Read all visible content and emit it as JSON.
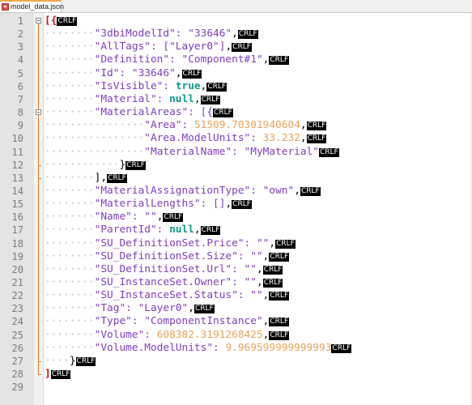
{
  "tab": {
    "label": "model_data.json"
  },
  "crlf_label": "CRLF",
  "lines": [
    {
      "n": "1",
      "segs": [
        {
          "t": "br",
          "v": "[{"
        }
      ]
    },
    {
      "n": "2",
      "segs": [
        {
          "t": "ws",
          "v": "········"
        },
        {
          "t": "str",
          "v": "\"3dbiModelId\": \"33646\""
        },
        {
          "t": "punc",
          "v": ","
        }
      ]
    },
    {
      "n": "3",
      "segs": [
        {
          "t": "ws",
          "v": "········"
        },
        {
          "t": "str",
          "v": "\"AllTags\": [\"Layer0\"]"
        },
        {
          "t": "punc",
          "v": ","
        }
      ]
    },
    {
      "n": "4",
      "segs": [
        {
          "t": "ws",
          "v": "········"
        },
        {
          "t": "str",
          "v": "\"Definition\": \"Component#1\""
        },
        {
          "t": "punc",
          "v": ","
        }
      ]
    },
    {
      "n": "5",
      "segs": [
        {
          "t": "ws",
          "v": "········"
        },
        {
          "t": "str",
          "v": "\"Id\": \"33646\""
        },
        {
          "t": "punc",
          "v": ","
        }
      ]
    },
    {
      "n": "6",
      "segs": [
        {
          "t": "ws",
          "v": "········"
        },
        {
          "t": "str",
          "v": "\"IsVisible\": "
        },
        {
          "t": "kw",
          "v": "true"
        },
        {
          "t": "punc",
          "v": ","
        }
      ]
    },
    {
      "n": "7",
      "segs": [
        {
          "t": "ws",
          "v": "········"
        },
        {
          "t": "str",
          "v": "\"Material\": "
        },
        {
          "t": "kw",
          "v": "null"
        },
        {
          "t": "punc",
          "v": ","
        }
      ]
    },
    {
      "n": "8",
      "segs": [
        {
          "t": "ws",
          "v": "········"
        },
        {
          "t": "str",
          "v": "\"MaterialAreas\": [{"
        }
      ]
    },
    {
      "n": "9",
      "segs": [
        {
          "t": "ws",
          "v": "················"
        },
        {
          "t": "str",
          "v": "\"Area\": "
        },
        {
          "t": "num",
          "v": "51509.70301940604"
        },
        {
          "t": "punc",
          "v": ","
        }
      ]
    },
    {
      "n": "10",
      "segs": [
        {
          "t": "ws",
          "v": "················"
        },
        {
          "t": "str",
          "v": "\"Area.ModelUnits\": "
        },
        {
          "t": "num",
          "v": "33.232"
        },
        {
          "t": "punc",
          "v": ","
        }
      ]
    },
    {
      "n": "11",
      "segs": [
        {
          "t": "ws",
          "v": "················"
        },
        {
          "t": "str",
          "v": "\"MaterialName\": \"MyMaterial\""
        }
      ]
    },
    {
      "n": "12",
      "segs": [
        {
          "t": "ws",
          "v": "············"
        },
        {
          "t": "punc",
          "v": "}"
        }
      ]
    },
    {
      "n": "13",
      "segs": [
        {
          "t": "ws",
          "v": "········"
        },
        {
          "t": "punc",
          "v": "],"
        }
      ]
    },
    {
      "n": "14",
      "segs": [
        {
          "t": "ws",
          "v": "········"
        },
        {
          "t": "str",
          "v": "\"MaterialAssignationType\": \"own\""
        },
        {
          "t": "punc",
          "v": ","
        }
      ]
    },
    {
      "n": "15",
      "segs": [
        {
          "t": "ws",
          "v": "········"
        },
        {
          "t": "str",
          "v": "\"MaterialLengths\": []"
        },
        {
          "t": "punc",
          "v": ","
        }
      ]
    },
    {
      "n": "16",
      "segs": [
        {
          "t": "ws",
          "v": "········"
        },
        {
          "t": "str",
          "v": "\"Name\": \"\""
        },
        {
          "t": "punc",
          "v": ","
        }
      ]
    },
    {
      "n": "17",
      "segs": [
        {
          "t": "ws",
          "v": "········"
        },
        {
          "t": "str",
          "v": "\"ParentId\": "
        },
        {
          "t": "kw",
          "v": "null"
        },
        {
          "t": "punc",
          "v": ","
        }
      ]
    },
    {
      "n": "18",
      "segs": [
        {
          "t": "ws",
          "v": "········"
        },
        {
          "t": "str",
          "v": "\"SU_DefinitionSet.Price\": \"\""
        },
        {
          "t": "punc",
          "v": ","
        }
      ]
    },
    {
      "n": "19",
      "segs": [
        {
          "t": "ws",
          "v": "········"
        },
        {
          "t": "str",
          "v": "\"SU_DefinitionSet.Size\": \"\""
        },
        {
          "t": "punc",
          "v": ","
        }
      ]
    },
    {
      "n": "20",
      "segs": [
        {
          "t": "ws",
          "v": "········"
        },
        {
          "t": "str",
          "v": "\"SU_DefinitionSet.Url\": \"\""
        },
        {
          "t": "punc",
          "v": ","
        }
      ]
    },
    {
      "n": "21",
      "segs": [
        {
          "t": "ws",
          "v": "········"
        },
        {
          "t": "str",
          "v": "\"SU_InstanceSet.Owner\": \"\""
        },
        {
          "t": "punc",
          "v": ","
        }
      ]
    },
    {
      "n": "22",
      "segs": [
        {
          "t": "ws",
          "v": "········"
        },
        {
          "t": "str",
          "v": "\"SU_InstanceSet.Status\": \"\""
        },
        {
          "t": "punc",
          "v": ","
        }
      ]
    },
    {
      "n": "23",
      "segs": [
        {
          "t": "ws",
          "v": "········"
        },
        {
          "t": "str",
          "v": "\"Tag\": \"Layer0\""
        },
        {
          "t": "punc",
          "v": ","
        }
      ]
    },
    {
      "n": "24",
      "segs": [
        {
          "t": "ws",
          "v": "········"
        },
        {
          "t": "str",
          "v": "\"Type\": \"ComponentInstance\""
        },
        {
          "t": "punc",
          "v": ","
        }
      ]
    },
    {
      "n": "25",
      "segs": [
        {
          "t": "ws",
          "v": "········"
        },
        {
          "t": "str",
          "v": "\"Volume\": "
        },
        {
          "t": "num",
          "v": "608382.3191268425"
        },
        {
          "t": "punc",
          "v": ","
        }
      ]
    },
    {
      "n": "26",
      "segs": [
        {
          "t": "ws",
          "v": "········"
        },
        {
          "t": "str",
          "v": "\"Volume.ModelUnits\": "
        },
        {
          "t": "num",
          "v": "9.969599999999993"
        }
      ]
    },
    {
      "n": "27",
      "segs": [
        {
          "t": "ws",
          "v": "····"
        },
        {
          "t": "punc",
          "v": "}"
        }
      ]
    },
    {
      "n": "28",
      "segs": [
        {
          "t": "br",
          "v": "]"
        }
      ]
    },
    {
      "n": "29",
      "segs": [],
      "nocrlf": true
    }
  ],
  "colors": {
    "accent_tab": "#f3a84b",
    "fold": "#e07a2f",
    "crlf_bg": "#000000"
  }
}
